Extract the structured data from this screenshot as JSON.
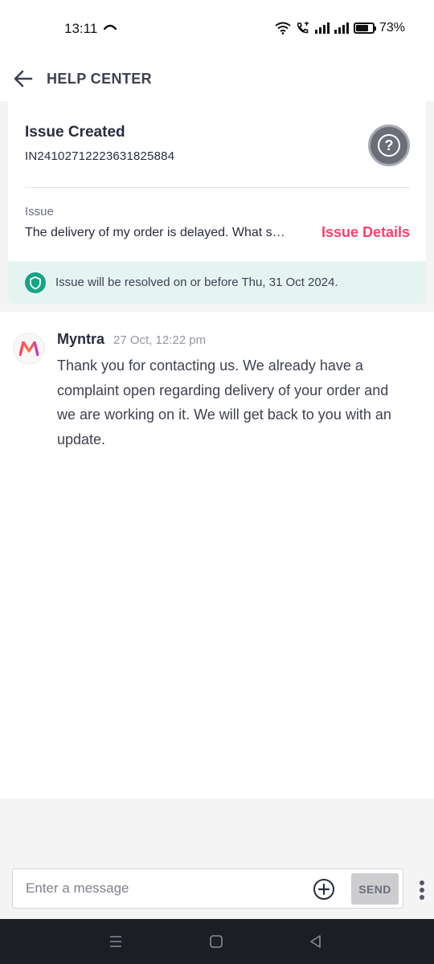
{
  "status_bar": {
    "time": "13:11",
    "battery_percent": "73%",
    "battery_level": 0.73
  },
  "header": {
    "title": "HELP CENTER"
  },
  "issue": {
    "title": "Issue Created",
    "id": "IN24102712223631825884",
    "label": "Issue",
    "description": "The delivery of my order is delayed. What s…",
    "details_link": "Issue Details",
    "resolution_text": "Issue will be resolved on or before Thu, 31 Oct 2024."
  },
  "chat": {
    "messages": [
      {
        "sender": "Myntra",
        "timestamp": "27 Oct, 12:22 pm",
        "text": "Thank you for contacting us. We already have a complaint open regarding delivery of your order and we are working on it. We will get back to you with an update."
      }
    ]
  },
  "composer": {
    "placeholder": "Enter a message",
    "value": "",
    "send_label": "SEND"
  },
  "colors": {
    "accent": "#ff3f6c",
    "resolve_bg": "#e6f4f1",
    "shield": "#14a587",
    "nav_bg": "#1c1e26"
  },
  "icons": [
    "back-arrow-icon",
    "help-icon",
    "shield-icon",
    "myntra-logo",
    "plus-circle-icon",
    "more-vertical-icon",
    "menu-icon",
    "home-icon",
    "back-triangle-icon"
  ]
}
